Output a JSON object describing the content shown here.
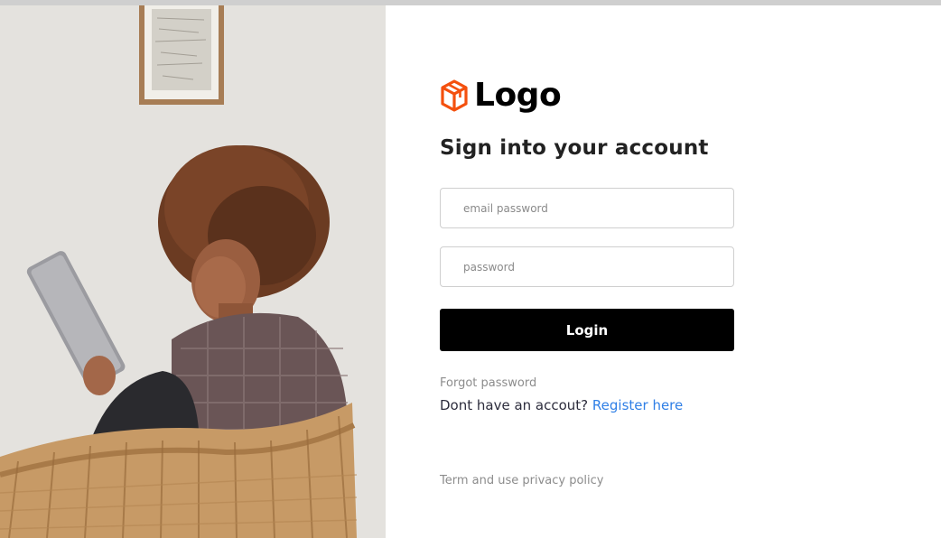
{
  "brand": {
    "name": "Logo",
    "icon": "cube-icon",
    "icon_color": "#f4500e"
  },
  "photo": {
    "description_icon": "woman-with-tablet-photo"
  },
  "form": {
    "title": "Sign into your account",
    "email_placeholder": "email password",
    "password_placeholder": "password",
    "login_label": "Login",
    "forgot_password": "Forgot password",
    "register_prompt": "Dont have an accout?",
    "register_link": "Register here",
    "terms": "Term and use privacy policy"
  },
  "colors": {
    "button_bg": "#000000",
    "link_blue": "#2f7fe6",
    "muted_text": "#8c8c8c"
  }
}
